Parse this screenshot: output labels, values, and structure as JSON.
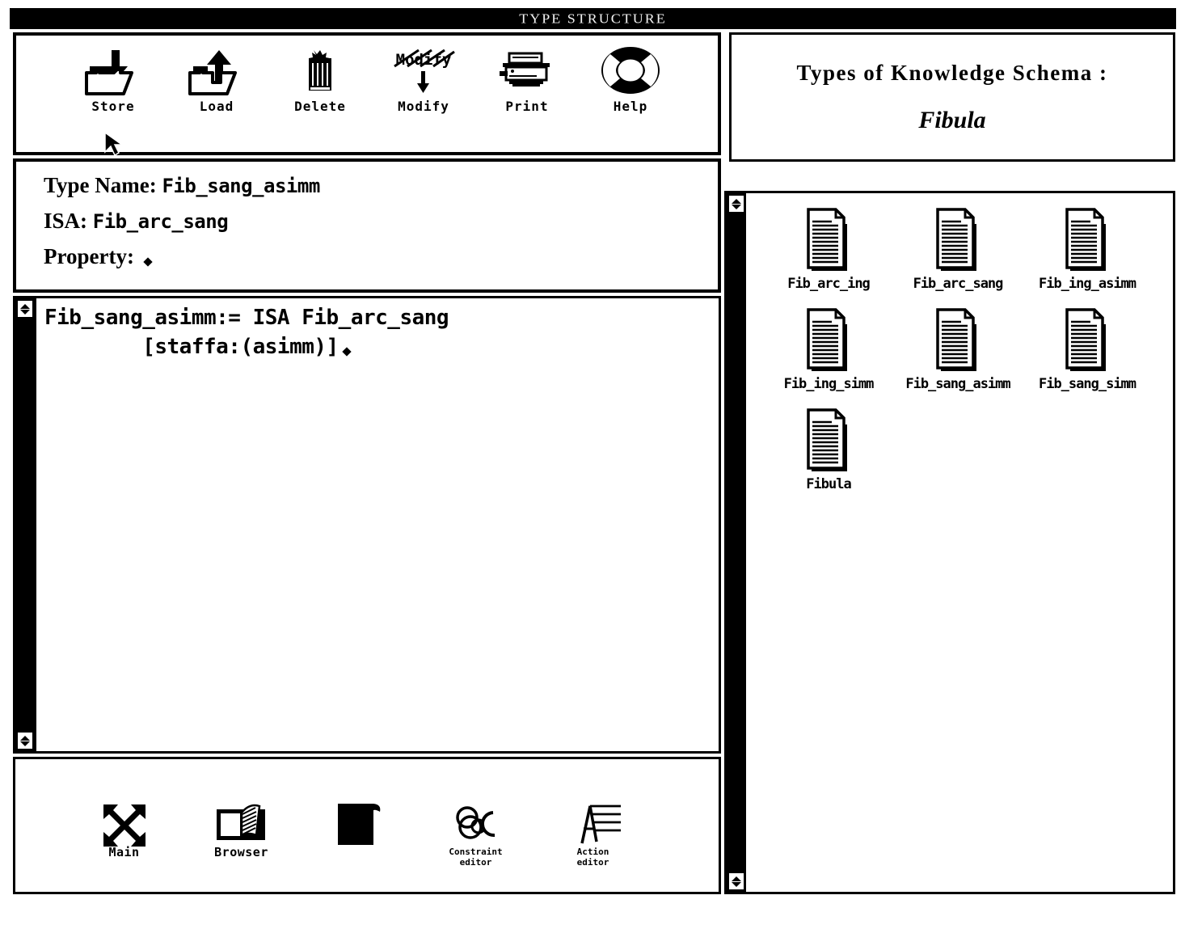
{
  "window": {
    "title": "TYPE STRUCTURE"
  },
  "toolbar": {
    "items": [
      {
        "label": "Store",
        "icon": "folder-down-arrow-icon"
      },
      {
        "label": "Load",
        "icon": "folder-up-arrow-icon"
      },
      {
        "label": "Delete",
        "icon": "trash-can-icon"
      },
      {
        "label": "Modify",
        "icon": "struck-modify-arrow-icon",
        "glyph_text": "Modify"
      },
      {
        "label": "Print",
        "icon": "printer-icon"
      },
      {
        "label": "Help",
        "icon": "life-preserver-icon"
      }
    ]
  },
  "info": {
    "type_name_label": "Type Name:",
    "type_name_value": "Fib_sang_asimm",
    "isa_label": "ISA:",
    "isa_value": "Fib_arc_sang",
    "property_label": "Property:",
    "property_value": ""
  },
  "editor": {
    "line1": "Fib_sang_asimm:= ISA Fib_arc_sang",
    "line2": "        [staffa:(asimm)]"
  },
  "bottom_toolbar": {
    "items": [
      {
        "label": "Main",
        "icon": "four-way-arrows-icon"
      },
      {
        "label": "Browser",
        "icon": "open-book-icon"
      },
      {
        "label": "",
        "icon": "filled-black-block-icon"
      },
      {
        "label": "Constraint\neditor",
        "icon": "linked-rings-c-icon"
      },
      {
        "label": "Action\neditor",
        "icon": "letter-a-lines-icon"
      }
    ]
  },
  "schema": {
    "header_title": "Types of Knowledge Schema :",
    "header_name": "Fibula",
    "documents": [
      {
        "label": "Fib_arc_ing"
      },
      {
        "label": "Fib_arc_sang"
      },
      {
        "label": "Fib_ing_asimm"
      },
      {
        "label": "Fib_ing_simm"
      },
      {
        "label": "Fib_sang_asimm"
      },
      {
        "label": "Fib_sang_simm"
      },
      {
        "label": "Fibula"
      }
    ]
  },
  "colors": {
    "foreground": "#000000",
    "background": "#ffffff",
    "titlebar_bg": "#000000",
    "titlebar_fg": "#f2f2f2"
  }
}
